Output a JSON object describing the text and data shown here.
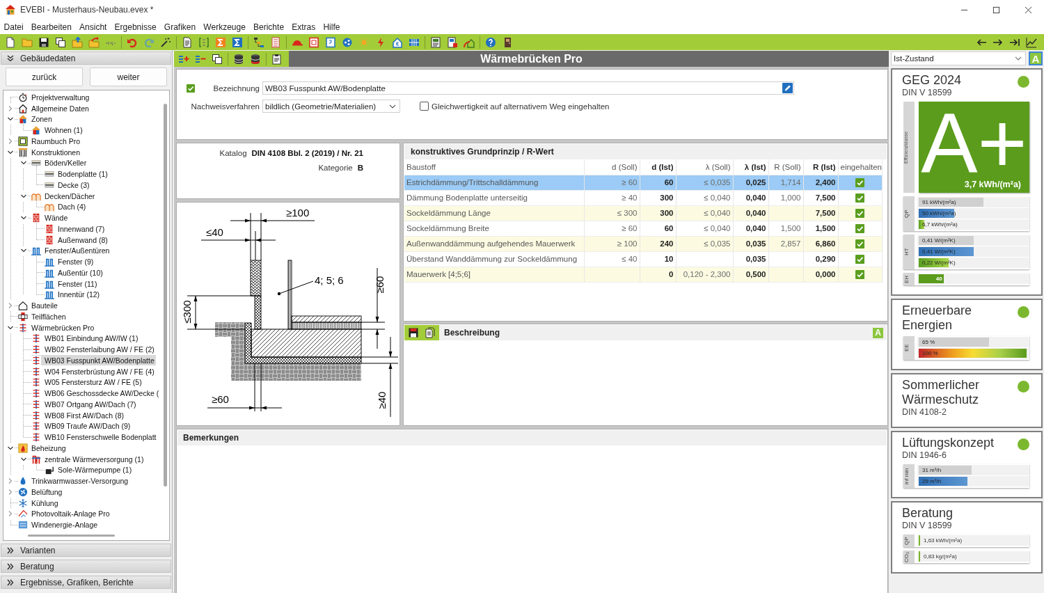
{
  "window": {
    "title": "EVEBI - Musterhaus-Neubau.evex *"
  },
  "menu": [
    "Datei",
    "Bearbeiten",
    "Ansicht",
    "Ergebnisse",
    "Grafiken",
    "Werkzeuge",
    "Berichte",
    "Extras",
    "Hilfe"
  ],
  "sidebar": {
    "sections": [
      {
        "title": "Gebäudedaten",
        "expanded": true
      },
      {
        "title": "Varianten",
        "expanded": false
      },
      {
        "title": "Beratung",
        "expanded": false
      },
      {
        "title": "Ergebnisse, Grafiken, Berichte",
        "expanded": false
      }
    ],
    "nav_buttons": [
      "zurück",
      "weiter"
    ],
    "tree": [
      {
        "label": "Projektverwaltung",
        "kind": "project",
        "selected": false
      },
      {
        "label": "Allgemeine Daten",
        "kind": "house",
        "expanded": false,
        "selected": false
      },
      {
        "label": "Zonen",
        "kind": "zone",
        "expanded": true,
        "selected": false,
        "children": [
          {
            "label": "Wohnen (1)",
            "kind": "zone",
            "selected": false
          }
        ]
      },
      {
        "label": "Raumbuch Pro",
        "kind": "roombook",
        "expanded": false,
        "selected": false
      },
      {
        "label": "Konstruktionen",
        "kind": "construction",
        "expanded": true,
        "selected": false,
        "children": [
          {
            "label": "Böden/Keller",
            "kind": "floor",
            "expanded": true,
            "selected": false,
            "children": [
              {
                "label": "Bodenplatte (1)",
                "kind": "floor",
                "selected": false
              },
              {
                "label": "Decke (3)",
                "kind": "floor",
                "selected": false
              }
            ]
          },
          {
            "label": "Decken/Dächer",
            "kind": "roof",
            "expanded": true,
            "selected": false,
            "children": [
              {
                "label": "Dach (4)",
                "kind": "roof",
                "selected": false
              }
            ]
          },
          {
            "label": "Wände",
            "kind": "wall",
            "expanded": true,
            "selected": false,
            "children": [
              {
                "label": "Innenwand (7)",
                "kind": "wall",
                "selected": false
              },
              {
                "label": "Außenwand (8)",
                "kind": "wall",
                "selected": false
              }
            ]
          },
          {
            "label": "Fenster/Außentüren",
            "kind": "window",
            "expanded": true,
            "selected": false,
            "children": [
              {
                "label": "Fenster (9)",
                "kind": "window",
                "selected": false
              },
              {
                "label": "Außentür (10)",
                "kind": "window",
                "selected": false
              },
              {
                "label": "Fenster (11)",
                "kind": "window",
                "selected": false
              },
              {
                "label": "Innentür (12)",
                "kind": "window",
                "selected": false
              }
            ]
          }
        ]
      },
      {
        "label": "Bauteile",
        "kind": "component",
        "expanded": false,
        "selected": false
      },
      {
        "label": "Teilflächen",
        "kind": "area",
        "selected": false
      },
      {
        "label": "Wärmebrücken Pro",
        "kind": "bridge",
        "expanded": true,
        "selected": false,
        "children": [
          {
            "label": "WB01 Einbindung AW/IW (1)",
            "kind": "bridge",
            "selected": false
          },
          {
            "label": "WB02 Fensterlaibung AW / FE (2)",
            "kind": "bridge",
            "selected": false
          },
          {
            "label": "WB03 Fusspunkt AW/Bodenplatte",
            "kind": "bridge",
            "selected": true
          },
          {
            "label": "W04 Fensterbrüstung AW / FE (4)",
            "kind": "bridge",
            "selected": false
          },
          {
            "label": "W05 Fenstersturz AW / FE (5)",
            "kind": "bridge",
            "selected": false
          },
          {
            "label": "WB06 Geschossdecke AW/Decke (",
            "kind": "bridge",
            "selected": false
          },
          {
            "label": "WB07 Ortgang AW/Dach (7)",
            "kind": "bridge",
            "selected": false
          },
          {
            "label": "WB08 First AW/Dach (8)",
            "kind": "bridge",
            "selected": false
          },
          {
            "label": "WB09 Traufe AW/Dach (9)",
            "kind": "bridge",
            "selected": false
          },
          {
            "label": "WB10 Fensterschwelle Bodenplatt",
            "kind": "bridge",
            "selected": false
          }
        ]
      },
      {
        "label": "Beheizung",
        "kind": "heating",
        "expanded": true,
        "selected": false,
        "children": [
          {
            "label": "zentrale Wärmeversorgung (1)",
            "kind": "heat-supply",
            "expanded": true,
            "selected": false,
            "children": [
              {
                "label": "Sole-Wärmepumpe (1)",
                "kind": "pump",
                "selected": false
              }
            ]
          }
        ]
      },
      {
        "label": "Trinkwarmwasser-Versorgung",
        "kind": "water",
        "expanded": false,
        "selected": false
      },
      {
        "label": "Belüftung",
        "kind": "ventilation",
        "expanded": false,
        "selected": false
      },
      {
        "label": "Kühlung",
        "kind": "cooling",
        "selected": false
      },
      {
        "label": "Photovoltaik-Anlage Pro",
        "kind": "solar",
        "expanded": false,
        "selected": false
      },
      {
        "label": "Windenergie-Anlage",
        "kind": "wind",
        "selected": false
      }
    ]
  },
  "module": {
    "title": "Wärmebrücken Pro"
  },
  "form": {
    "enabled": {
      "checked": true
    },
    "name": {
      "label": "Bezeichnung",
      "value": "WB03 Fusspunkt AW/Bodenplatte"
    },
    "method": {
      "label": "Nachweisverfahren",
      "value": "bildlich (Geometrie/Materialien)"
    },
    "equivalence": {
      "label": "Gleichwertigkeit auf alternativem Weg eingehalten",
      "checked": false
    }
  },
  "catalog": {
    "label": "Katalog",
    "value": "DIN 4108 Bbl. 2 (2019) / Nr. 21",
    "category_label": "Kategorie",
    "category": "B"
  },
  "detail_drawing": {
    "labels": [
      "≥100",
      "≤40",
      "4; 5; 6",
      "≥60",
      "≤300",
      "≥60",
      "≥40"
    ]
  },
  "table": {
    "title": "konstruktives Grundprinzip / R-Wert",
    "columns": [
      {
        "label": "Baustoff",
        "kind": "text"
      },
      {
        "label": "d (Soll)",
        "kind": "target"
      },
      {
        "label": "d (Ist)",
        "kind": "actual"
      },
      {
        "label": "λ (Soll)",
        "kind": "target"
      },
      {
        "label": "λ (Ist)",
        "kind": "actual"
      },
      {
        "label": "R (Soll)",
        "kind": "target"
      },
      {
        "label": "R (Ist)",
        "kind": "actual"
      },
      {
        "label": "eingehalten",
        "kind": "check"
      }
    ],
    "rows": [
      {
        "cells": [
          "Estrichdämmung/Trittschalldämmung",
          "≥ 60",
          "60",
          "≤ 0,035",
          "0,025",
          "1,714",
          "2,400"
        ],
        "compliant": true,
        "selected": true
      },
      {
        "cells": [
          "Dämmung Bodenplatte unterseitig",
          "≥ 40",
          "300",
          "≤ 0,040",
          "0,040",
          "1,000",
          "7,500"
        ],
        "compliant": true,
        "selected": false
      },
      {
        "cells": [
          "Sockeldämmung Länge",
          "≤ 300",
          "300",
          "≤ 0,040",
          "0,040",
          null,
          "7,500"
        ],
        "compliant": true,
        "selected": false
      },
      {
        "cells": [
          "Sockeldämmung Breite",
          "≥ 60",
          "60",
          "≤ 0,040",
          "0,040",
          "1,500",
          "1,500"
        ],
        "compliant": true,
        "selected": false
      },
      {
        "cells": [
          "Außenwanddämmung aufgehendes Mauerwerk",
          "≥ 100",
          "240",
          "≤ 0,035",
          "0,035",
          "2,857",
          "6,860"
        ],
        "compliant": true,
        "selected": false
      },
      {
        "cells": [
          "Überstand Wanddämmung zur Sockeldämmung",
          "≤ 40",
          "10",
          null,
          "0,035",
          null,
          "0,290"
        ],
        "compliant": true,
        "selected": false
      },
      {
        "cells": [
          "Mauerwerk [4;5;6]",
          null,
          "0",
          "0,120 - 2,300",
          "0,500",
          null,
          "0,000"
        ],
        "compliant": true,
        "selected": false
      }
    ]
  },
  "description": {
    "title": "Beschreibung",
    "toggle": "A"
  },
  "remarks": {
    "title": "Bemerkungen"
  },
  "status_panel": {
    "scenario": {
      "value": "Ist-Zustand",
      "toggle": "A"
    },
    "cards": [
      {
        "title": "GEG 2024",
        "subtitle": "DIN V 18599",
        "color": "#7cb82f",
        "efficiency": {
          "axis_label": "Effizienzklasse",
          "class": "A+",
          "value": "3,7 kWh/(m²a)"
        },
        "groups": [
          {
            "label": "QP",
            "bars": [
              {
                "kind": "reference",
                "text": "91 kWh/(m²a)",
                "level": 0.6
              },
              {
                "kind": "limit",
                "text": "50 kWh/(m²a)",
                "level": 0.33
              },
              {
                "kind": "actual",
                "text": "6,7 kWh/(m²a)",
                "level": 0.05
              }
            ]
          },
          {
            "label": "HT",
            "bars": [
              {
                "kind": "reference",
                "text": "0,41 W/(m²K)",
                "level": 0.51
              },
              {
                "kind": "limit",
                "text": "0,41 W/(m²K)",
                "level": 0.51
              },
              {
                "kind": "actual",
                "text": "0,22 W/(m²K)",
                "level": 0.28
              }
            ]
          },
          {
            "label": "EH",
            "bars": [
              {
                "kind": "score",
                "text": "40",
                "level": 0.23
              }
            ]
          }
        ]
      },
      {
        "title": "Erneuerbare Energien",
        "color": "#7cb82f",
        "groups": [
          {
            "label": "EE",
            "bars": [
              {
                "kind": "reference",
                "text": "65 %",
                "level": 0.65
              },
              {
                "kind": "scale",
                "text": "100 %",
                "level": 1
              }
            ]
          }
        ]
      },
      {
        "title": "Sommerlicher Wärmeschutz",
        "subtitle": "DIN 4108-2",
        "color": "#7cb82f"
      },
      {
        "title": "Lüftungskonzept",
        "subtitle": "DIN 1946-6",
        "color": "#7cb82f",
        "groups": [
          {
            "label": "inf min",
            "bars": [
              {
                "kind": "reference",
                "text": "31 m³/h",
                "level": 0.49
              },
              {
                "kind": "limit",
                "text": "29 m³/h",
                "level": 0.45
              }
            ]
          }
        ]
      },
      {
        "title": "Beratung",
        "subtitle": "DIN V 18599",
        "groups": [
          {
            "label": "QP",
            "bars": [
              {
                "kind": "marker",
                "text": "1,63 kWh/(m²a)"
              }
            ]
          },
          {
            "label": "CO₂",
            "bars": [
              {
                "kind": "marker",
                "text": "0,83 kg/(m²a)"
              }
            ]
          }
        ]
      }
    ]
  }
}
